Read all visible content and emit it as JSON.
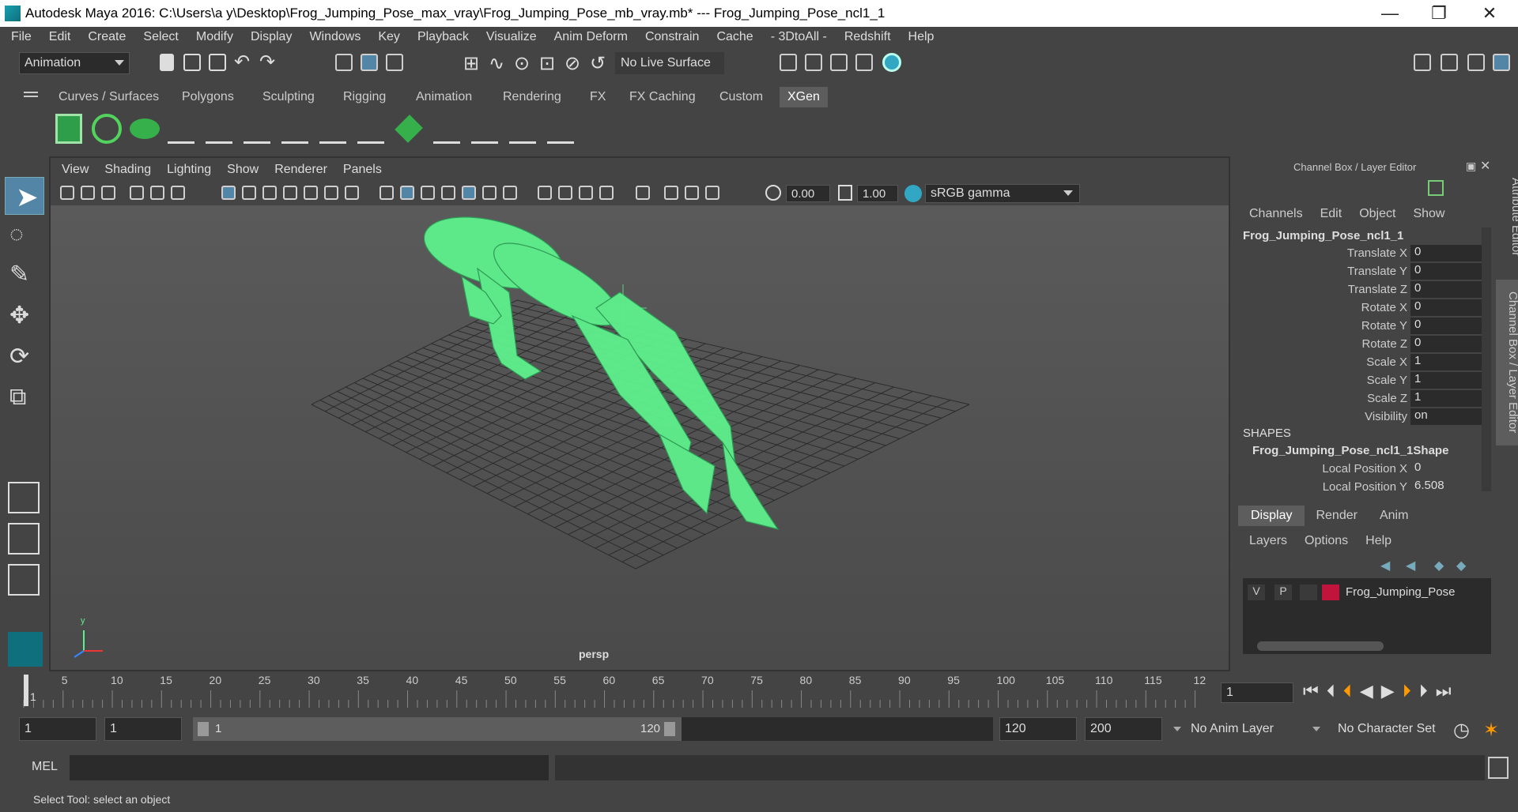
{
  "title_bar": {
    "title": "Autodesk Maya 2016: C:\\Users\\a y\\Desktop\\Frog_Jumping_Pose_max_vray\\Frog_Jumping_Pose_mb_vray.mb*   ---   Frog_Jumping_Pose_ncl1_1",
    "minimize": "—",
    "restore": "❐",
    "close": "✕"
  },
  "menu": [
    "File",
    "Edit",
    "Create",
    "Select",
    "Modify",
    "Display",
    "Windows",
    "Key",
    "Playback",
    "Visualize",
    "Anim Deform",
    "Constrain",
    "Cache",
    "- 3DtoAll -",
    "Redshift",
    "Help"
  ],
  "toolbar": {
    "mode_selector": "Animation",
    "live_surface": "No Live Surface"
  },
  "shelf_tabs": [
    "Curves / Surfaces",
    "Polygons",
    "Sculpting",
    "Rigging",
    "Animation",
    "Rendering",
    "FX",
    "FX Caching",
    "Custom",
    "XGen"
  ],
  "active_shelf_tab": "XGen",
  "viewport": {
    "menu": [
      "View",
      "Shading",
      "Lighting",
      "Show",
      "Renderer",
      "Panels"
    ],
    "exposure": "0.00",
    "gamma": "1.00",
    "color_space": "sRGB gamma",
    "camera_label": "persp",
    "wire_color": "#5ef08c"
  },
  "channel_box": {
    "header": "Channel Box / Layer Editor",
    "menu": [
      "Channels",
      "Edit",
      "Object",
      "Show"
    ],
    "object_name": "Frog_Jumping_Pose_ncl1_1",
    "channels": [
      {
        "name": "Translate X",
        "value": "0"
      },
      {
        "name": "Translate Y",
        "value": "0"
      },
      {
        "name": "Translate Z",
        "value": "0"
      },
      {
        "name": "Rotate X",
        "value": "0"
      },
      {
        "name": "Rotate Y",
        "value": "0"
      },
      {
        "name": "Rotate Z",
        "value": "0"
      },
      {
        "name": "Scale X",
        "value": "1"
      },
      {
        "name": "Scale Y",
        "value": "1"
      },
      {
        "name": "Scale Z",
        "value": "1"
      },
      {
        "name": "Visibility",
        "value": "on"
      }
    ],
    "shapes_header": "SHAPES",
    "shape_name": "Frog_Jumping_Pose_ncl1_1Shape",
    "shape_channels": [
      {
        "name": "Local Position X",
        "value": "0"
      },
      {
        "name": "Local Position Y",
        "value": "6.508"
      }
    ]
  },
  "layer_editor": {
    "tabs": [
      "Display",
      "Render",
      "Anim"
    ],
    "menu": [
      "Layers",
      "Options",
      "Help"
    ],
    "layer": {
      "v": "V",
      "p": "P",
      "name": "Frog_Jumping_Pose",
      "color": "#c0143c"
    }
  },
  "side_tabs": {
    "attribute_editor": "Attribute Editor",
    "channel_box": "Channel Box / Layer Editor"
  },
  "timeline": {
    "ticks": [
      "5",
      "10",
      "15",
      "20",
      "25",
      "30",
      "35",
      "40",
      "45",
      "50",
      "55",
      "60",
      "65",
      "70",
      "75",
      "80",
      "85",
      "90",
      "95",
      "100",
      "105",
      "110",
      "115",
      "12"
    ],
    "current_frame_marker": "1",
    "current_frame": "1"
  },
  "range": {
    "start": "1",
    "playback_start": "1",
    "slider_start": "1",
    "slider_end": "120",
    "playback_end": "120",
    "end": "200",
    "anim_layer": "No Anim Layer",
    "character_set": "No Character Set"
  },
  "command_line": {
    "label": "MEL"
  },
  "help_line": "Select Tool: select an object"
}
